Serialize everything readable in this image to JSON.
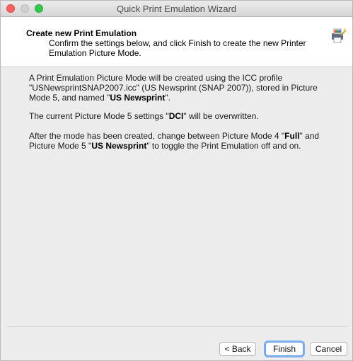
{
  "window": {
    "title": "Quick Print Emulation Wizard"
  },
  "header": {
    "heading": "Create new Print Emulation",
    "subtitle": "Confirm the settings below, and click Finish to create the new Printer Emulation Picture Mode."
  },
  "body": {
    "p1": {
      "t1": "A Print Emulation Picture Mode will be created using the ICC profile \"USNewsprintSNAP2007.icc\" (US Newsprint (SNAP 2007)), stored in Picture Mode 5, and named \"",
      "b1": "US Newsprint",
      "t2": "\"."
    },
    "p2": {
      "t1": "The current Picture Mode 5 settings \"",
      "b1": "DCI",
      "t2": "\" will be overwritten."
    },
    "p3": {
      "t1": "After the mode has been created, change between Picture Mode 4 \"",
      "b1": "Full",
      "t2": "\" and Picture Mode 5 \"",
      "b2": "US Newsprint",
      "t3": "\" to toggle the Print Emulation off and on."
    }
  },
  "buttons": {
    "back": "< Back",
    "finish": "Finish",
    "cancel": "Cancel"
  },
  "colors": {
    "close": "#fc615d",
    "minimize": "#d0d0d0",
    "maximize": "#36c84b",
    "default_button_ring": "#7fb1f0"
  },
  "icons": {
    "wizard": "printer-wizard-icon"
  }
}
